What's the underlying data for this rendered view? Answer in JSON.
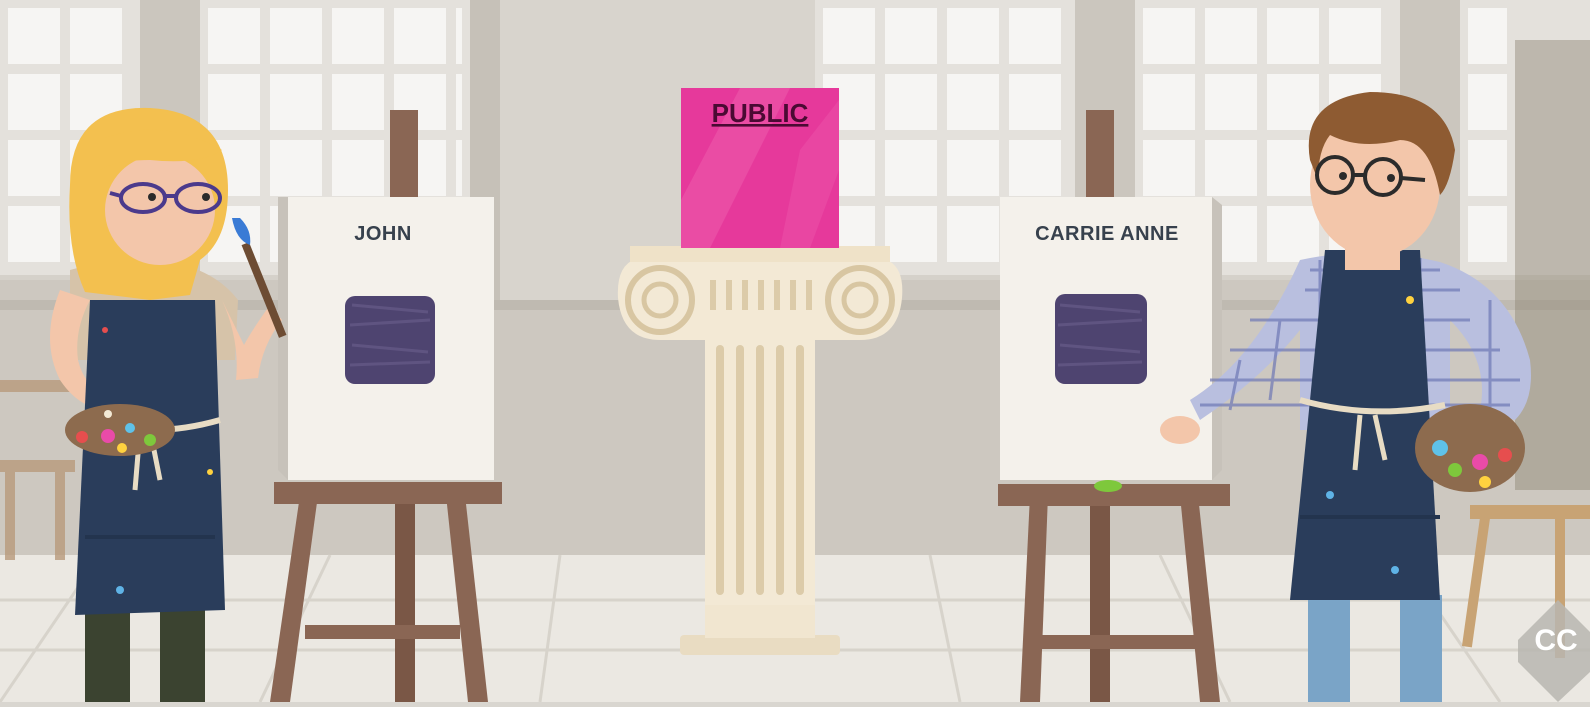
{
  "scene": {
    "left_canvas_label": "JOHN",
    "right_canvas_label": "CARRIE ANNE",
    "center_box_label": "PUBLIC",
    "corner_logo_text": "CC"
  },
  "colors": {
    "wall": "#d6d2cb",
    "window_light": "#f4f3f1",
    "floor": "#e9e6e0",
    "canvas": "#f3f0ea",
    "easel_wood": "#8a6654",
    "purple_square": "#4e4470",
    "public_box": "#e6399b",
    "pillar": "#f1e6d0",
    "apron": "#2a3d5b"
  },
  "icons": [
    "paint-palette-icon",
    "paintbrush-icon",
    "cc-logo-icon"
  ]
}
